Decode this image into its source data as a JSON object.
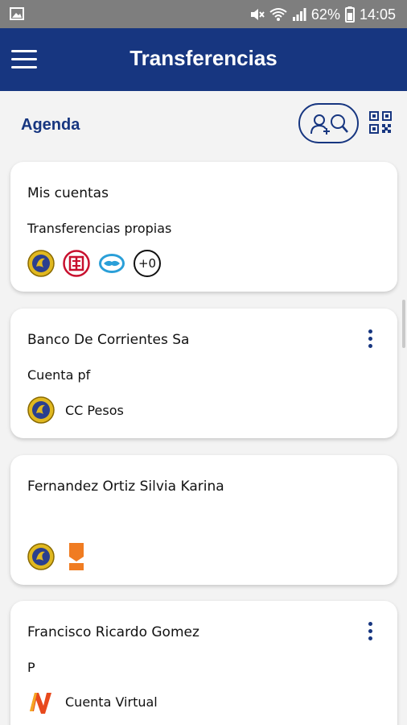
{
  "status_bar": {
    "battery_percent": "62%",
    "time": "14:05",
    "icons": [
      "gallery-icon",
      "mute-icon",
      "wifi-icon",
      "signal-icon",
      "battery-icon"
    ]
  },
  "app_bar": {
    "title": "Transferencias",
    "background": "#173680"
  },
  "agenda": {
    "label": "Agenda",
    "actions": [
      "contact-search-icon",
      "qr-code-icon"
    ]
  },
  "cards": [
    {
      "name": "Mis cuentas",
      "subtitle": "Transferencias propias",
      "logos": [
        "banco-corrientes-logo",
        "icbc-logo",
        "mercadopago-logo"
      ],
      "extra_count": "+0"
    },
    {
      "name": "Banco De Corrientes Sa",
      "subtitle": "Cuenta pf",
      "logo": "banco-corrientes-logo",
      "account_label": "CC Pesos"
    },
    {
      "name": "Fernandez Ortiz Silvia Karina",
      "subtitle": "",
      "logos": [
        "banco-corrientes-logo",
        "orange-bookmark-logo"
      ]
    },
    {
      "name": "Francisco Ricardo Gomez",
      "subtitle": "P",
      "logo": "naranja-x-logo",
      "account_label": "Cuenta Virtual"
    }
  ]
}
